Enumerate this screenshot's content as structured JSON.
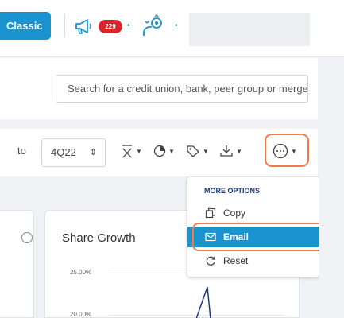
{
  "topbar": {
    "classic_label": "Classic",
    "notification_count": "229"
  },
  "search": {
    "placeholder": "Search for a credit union, bank, peer group or merger"
  },
  "controls": {
    "to_label": "to",
    "period_value": "4Q22",
    "period_arrow": "⇕"
  },
  "cards": {
    "main_title": "Share Growth",
    "y_ticks": [
      "25.00%",
      "20.00%"
    ]
  },
  "more_options": {
    "header": "MORE OPTIONS",
    "items": [
      {
        "label": "Copy",
        "icon": "copy-icon"
      },
      {
        "label": "Email",
        "icon": "email-icon"
      },
      {
        "label": "Reset",
        "icon": "reset-icon"
      }
    ]
  },
  "colors": {
    "accent": "#1a93cf",
    "highlight": "#ef7b45",
    "badge": "#d7262e"
  }
}
